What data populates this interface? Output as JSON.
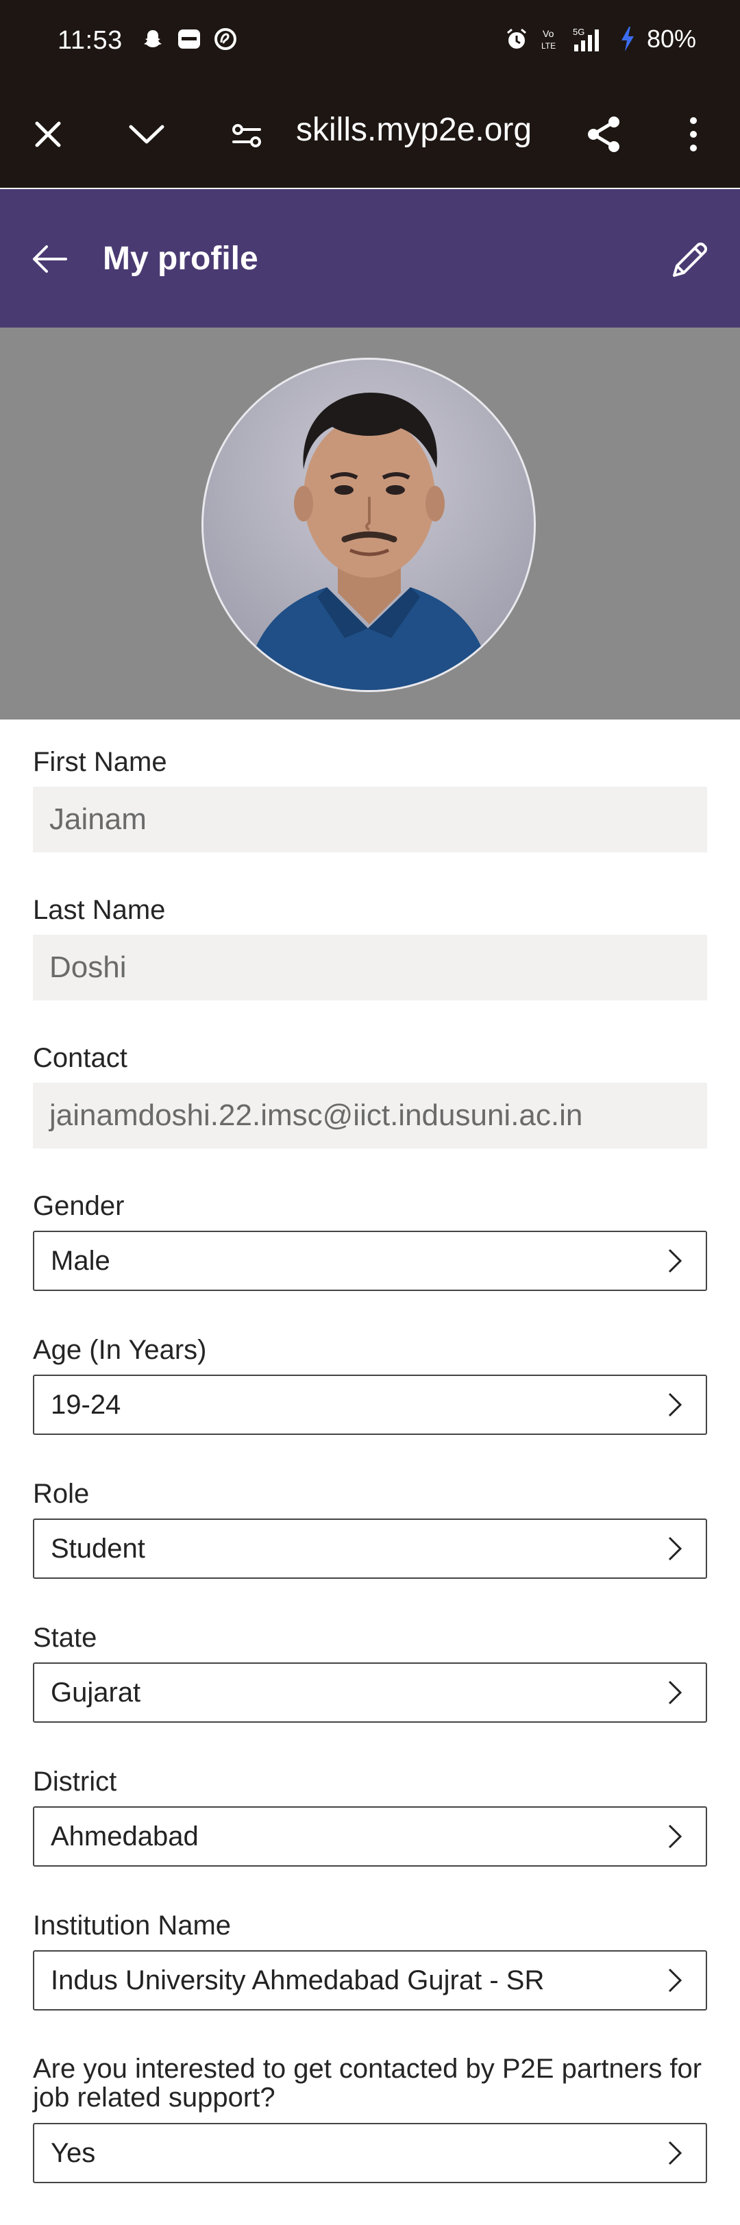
{
  "status_bar": {
    "time": "11:53",
    "network": "5G",
    "battery": "80%"
  },
  "browser": {
    "url": "skills.myp2e.org"
  },
  "header": {
    "title": "My profile"
  },
  "profile": {
    "fields": {
      "first_name": {
        "label": "First Name",
        "value": "Jainam"
      },
      "last_name": {
        "label": "Last Name",
        "value": "Doshi"
      },
      "contact": {
        "label": "Contact",
        "value": "jainamdoshi.22.imsc@iict.indusuni.ac.in"
      },
      "gender": {
        "label": "Gender",
        "value": "Male"
      },
      "age": {
        "label": "Age (In Years)",
        "value": "19-24"
      },
      "role": {
        "label": "Role",
        "value": "Student"
      },
      "state": {
        "label": "State",
        "value": "Gujarat"
      },
      "district": {
        "label": "District",
        "value": "Ahmedabad"
      },
      "institution": {
        "label": "Institution Name",
        "value": "Indus University Ahmedabad Gujrat - SR"
      },
      "contact_pref": {
        "label": "Are you interested to get contacted by P2E partners for job related support?",
        "value": "Yes"
      }
    }
  },
  "colors": {
    "system_bar": "#1d1612",
    "header": "#4a3a72",
    "photo_band": "#8a8a8a",
    "readonly_field": "#f2f1f0"
  }
}
